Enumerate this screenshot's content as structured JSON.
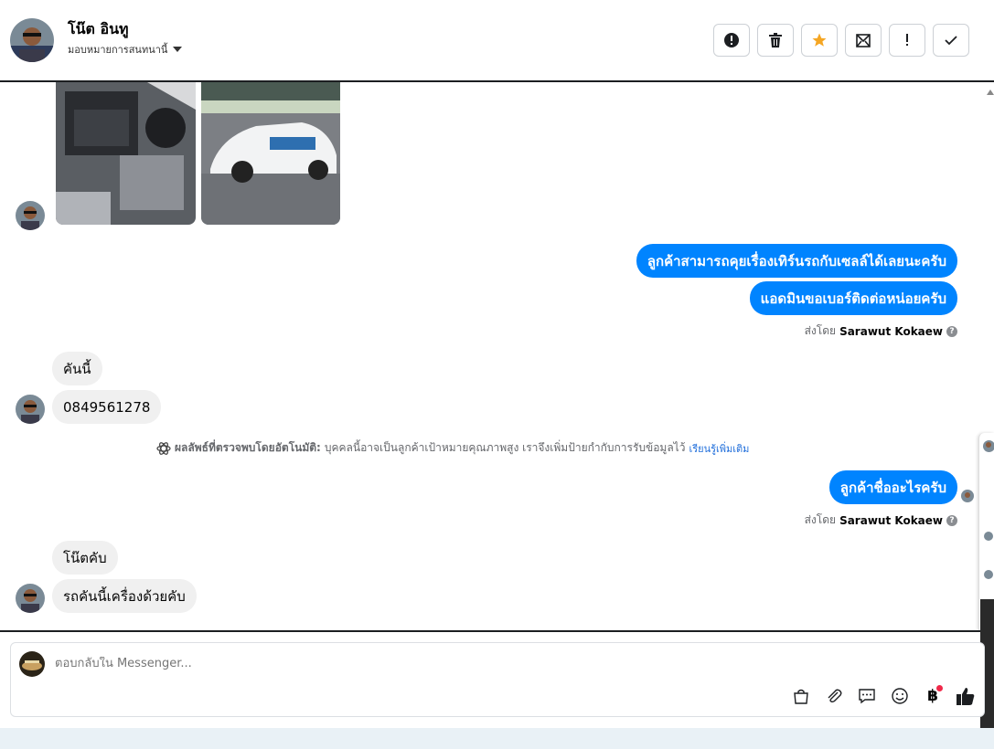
{
  "header": {
    "contact_name": "โน๊ต อินทู",
    "assign_label": "มอบหมายการสนทนานี้",
    "actions": [
      {
        "name": "spam",
        "icon": "alert-circle-icon"
      },
      {
        "name": "delete",
        "icon": "trash-icon"
      },
      {
        "name": "star",
        "icon": "star-icon",
        "color": "#f5a623"
      },
      {
        "name": "mark-unread",
        "icon": "envelope-icon"
      },
      {
        "name": "follow-up",
        "icon": "exclamation-icon"
      },
      {
        "name": "done",
        "icon": "check-icon"
      }
    ]
  },
  "messages": {
    "out1": "ลูกค้าสามารถคุยเรื่องเทิร์นรถกับเซลล์ได้เลยนะครับ",
    "out2": "แอดมินขอเบอร์ติดต่อหน่อยครับ",
    "sent_by_prefix": "ส่งโดย",
    "sent_by_name": "Sarawut Kokaew",
    "in1": "คันนี้",
    "in2": "0849561278",
    "notice_bold": "ผลลัพธ์ที่ตรวจพบโดยอัตโนมัติ:",
    "notice_text": "บุคคลนี้อาจเป็นลูกค้าเป้าหมายคุณภาพสูง เราจึงเพิ่มป้ายกำกับการรับข้อมูลไว้",
    "notice_link": "เรียนรู้เพิ่มเติม",
    "out3": "ลูกค้าชื่ออะไรครับ",
    "sent_by_prefix2": "ส่งโดย",
    "sent_by_name2": "Sarawut Kokaew",
    "in3": "โน๊ตคับ",
    "in4": "รถคันนี้เครื่องด้วยคับ"
  },
  "composer": {
    "placeholder": "ตอบกลับใน Messenger...",
    "tools": [
      "shop-bag-icon",
      "paperclip-icon",
      "chat-reply-icon",
      "emoji-icon",
      "baht-payment-icon",
      "thumbs-up-icon"
    ]
  },
  "colors": {
    "accent": "#0084ff",
    "incoming": "#f0f0f0",
    "star": "#f5a623"
  }
}
